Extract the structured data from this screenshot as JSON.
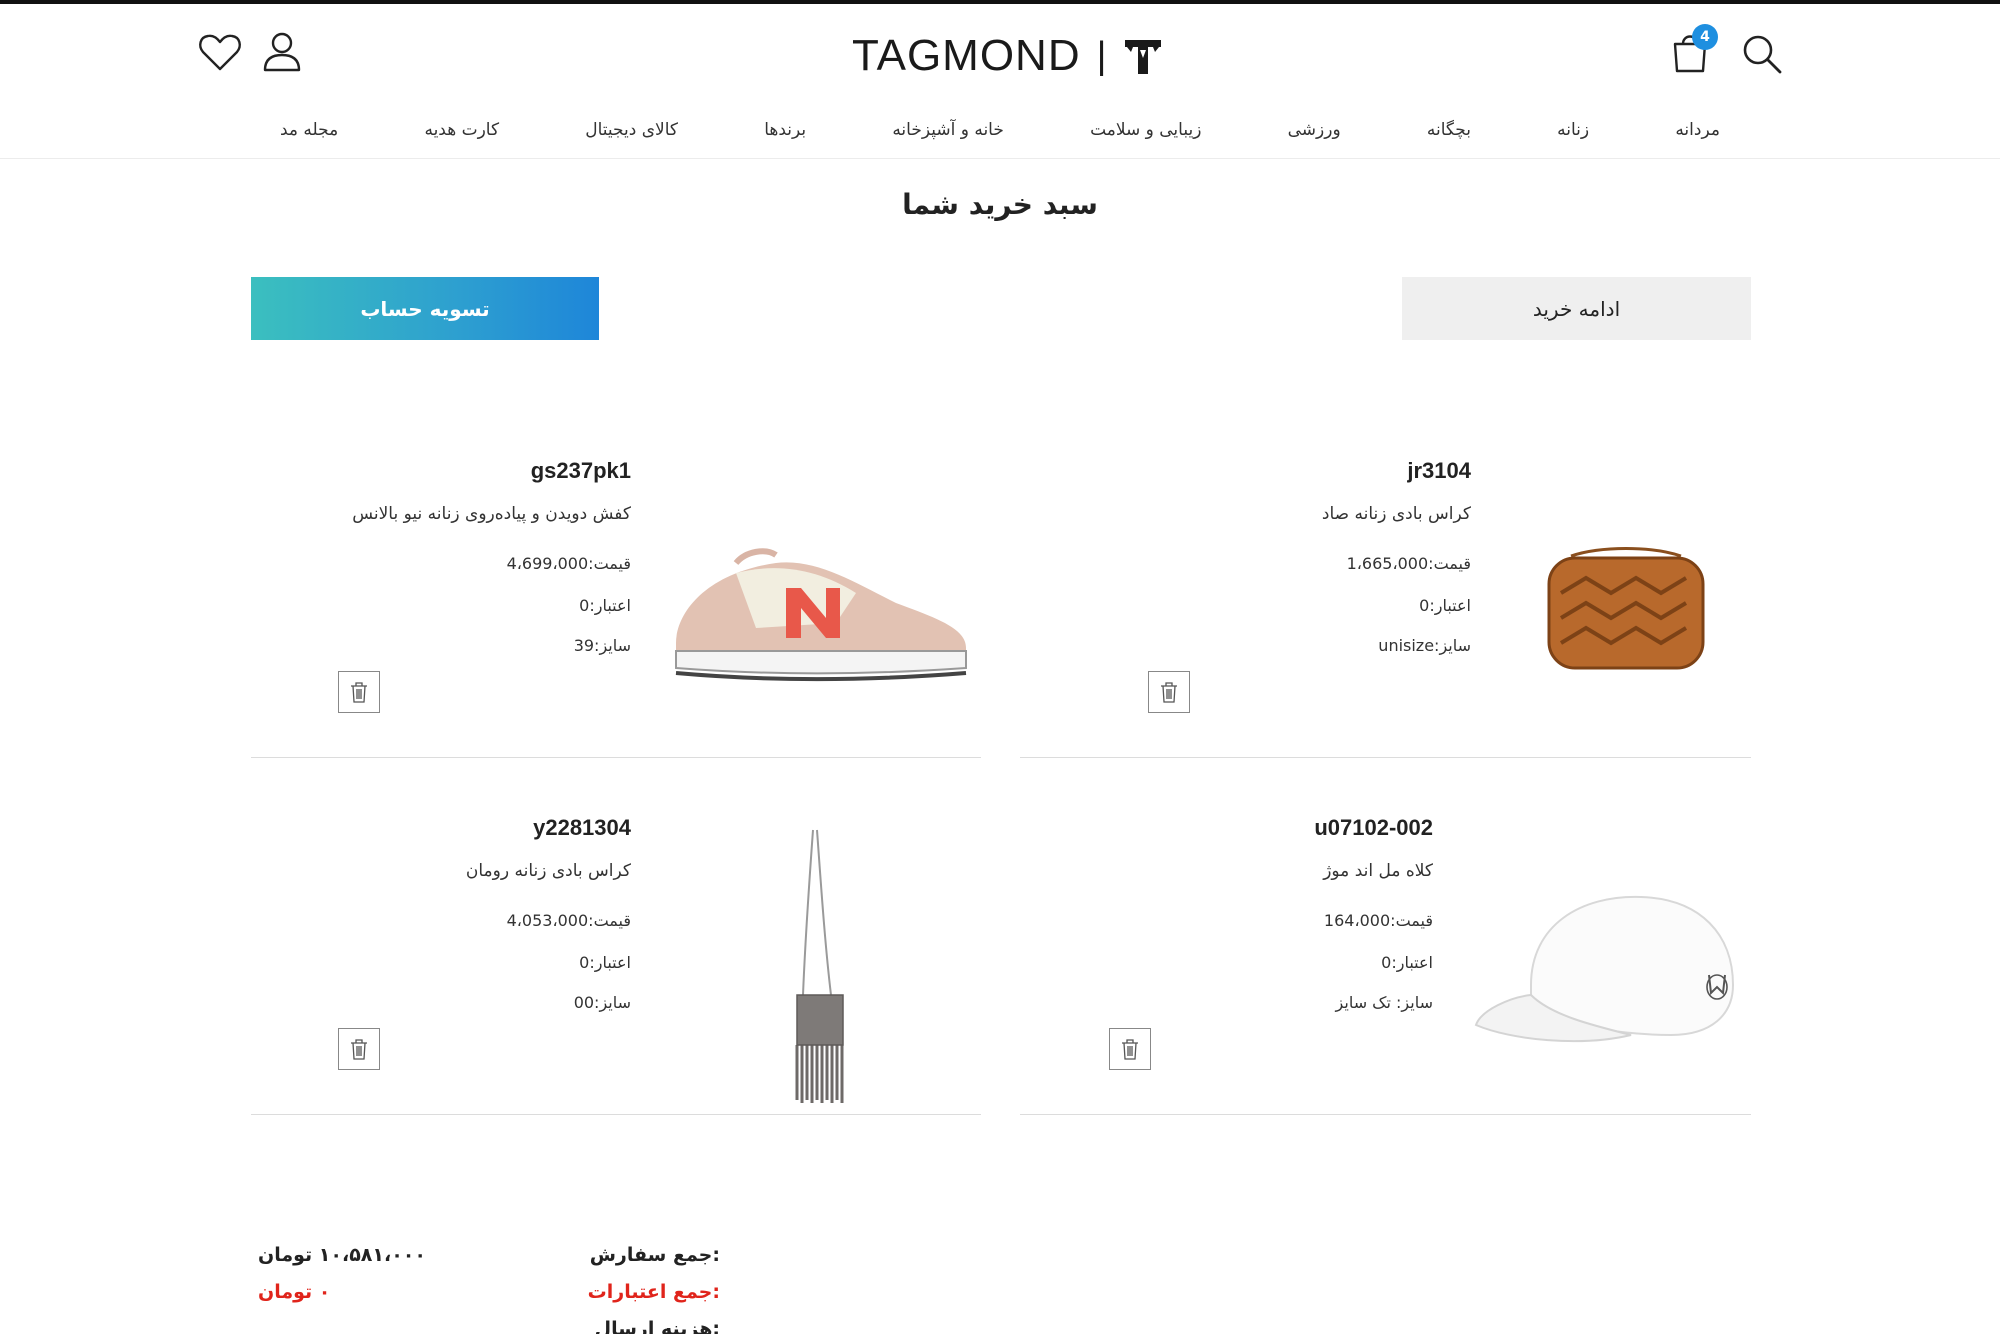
{
  "header": {
    "logo_text": "TAGMOND",
    "logo_sep": "|",
    "cart_count": "4"
  },
  "nav": {
    "items": [
      "مردانه",
      "زنانه",
      "بچگانه",
      "ورزشی",
      "زیبایی و سلامت",
      "خانه و آشپزخانه",
      "برندها",
      "کالای دیجیتال",
      "کارت هدیه",
      "مجله مد"
    ]
  },
  "page": {
    "title": "سبد خرید شما",
    "checkout_label": "تسویه حساب",
    "continue_label": "ادامه خرید"
  },
  "items": [
    {
      "code": "jr3104",
      "name": "کراس بادی زنانه صاد",
      "price": "قیمت:1،665،000",
      "credit": "اعتبار:0",
      "size": "سایز:unisize",
      "image": "brown-crossbody-bag"
    },
    {
      "code": "gs237pk1",
      "name": "کفش دویدن و پیاده‌روی زنانه نیو بالانس",
      "price": "قیمت:4،699،000",
      "credit": "اعتبار:0",
      "size": "سایز:39",
      "image": "pink-sneaker"
    },
    {
      "code": "u07102-002",
      "name": "کلاه مل اند موژ",
      "price": "قیمت:164،000",
      "credit": "اعتبار:0",
      "size": "سایز:   تک سایز",
      "image": "white-cap"
    },
    {
      "code": "y2281304",
      "name": "کراس بادی زنانه رومان",
      "price": "قیمت:4،053،000",
      "credit": "اعتبار:0",
      "size": "سایز:00",
      "image": "beaded-fringe-bag"
    }
  ],
  "summary": {
    "order_total_label": "جمع سفارش:",
    "order_total_value": "۱۰،۵۸۱،۰۰۰  تومان",
    "credits_label": "جمع اعتبارات:",
    "credits_value": "۰  تومان",
    "shipping_label": "هزینه ارسال:"
  },
  "colors": {
    "accent_start": "#3bbfbf",
    "accent_end": "#1e86d9",
    "badge": "#1e8fe0",
    "credit_red": "#e0241b"
  }
}
